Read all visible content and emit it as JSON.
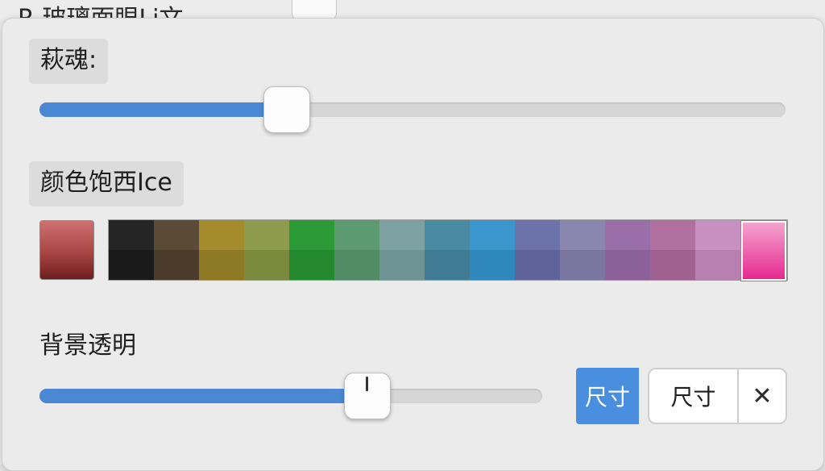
{
  "background": {
    "title": "R 玻璃面眼Li文"
  },
  "opacity": {
    "label": "萩魂:",
    "value_percent": 33
  },
  "color": {
    "label": "颜色饱西Ice",
    "current_swatch_color": "#a84545",
    "palette": [
      {
        "name": "black",
        "top": "#252525",
        "bottom": "#1a1a1a"
      },
      {
        "name": "dark-brown",
        "top": "#5a4a36",
        "bottom": "#4a3b2a"
      },
      {
        "name": "mustard",
        "top": "#a48c2c",
        "bottom": "#8e7a24"
      },
      {
        "name": "olive",
        "top": "#8e9a4c",
        "bottom": "#7c8a40"
      },
      {
        "name": "green",
        "top": "#2d9a38",
        "bottom": "#23882e"
      },
      {
        "name": "sage",
        "top": "#5d9a72",
        "bottom": "#528c66"
      },
      {
        "name": "grey-teal",
        "top": "#7ea2a2",
        "bottom": "#6e9494"
      },
      {
        "name": "teal-blue",
        "top": "#4a8aa2",
        "bottom": "#3f7c94"
      },
      {
        "name": "sky-blue",
        "top": "#3a96cc",
        "bottom": "#2f86ba"
      },
      {
        "name": "slate-blue",
        "top": "#6c72aa",
        "bottom": "#5e649a"
      },
      {
        "name": "lavender-grey",
        "top": "#8a86ae",
        "bottom": "#7a76a0"
      },
      {
        "name": "purple",
        "top": "#9a6ea8",
        "bottom": "#8c6098"
      },
      {
        "name": "mauve",
        "top": "#b070a0",
        "bottom": "#a06090"
      },
      {
        "name": "orchid",
        "top": "#c890c0",
        "bottom": "#b880b0"
      },
      {
        "name": "hot-pink",
        "top": "#f4a8d0",
        "bottom": "#e6258e"
      }
    ],
    "selected_index": 14
  },
  "background_transparency": {
    "label": "背景透明",
    "value_percent": 65
  },
  "buttons": {
    "primary_label": "尺寸",
    "secondary_label": "尺寸",
    "close_glyph": "✕"
  },
  "colors": {
    "accent": "#4a88d4",
    "button_accent": "#4a8ee0"
  }
}
